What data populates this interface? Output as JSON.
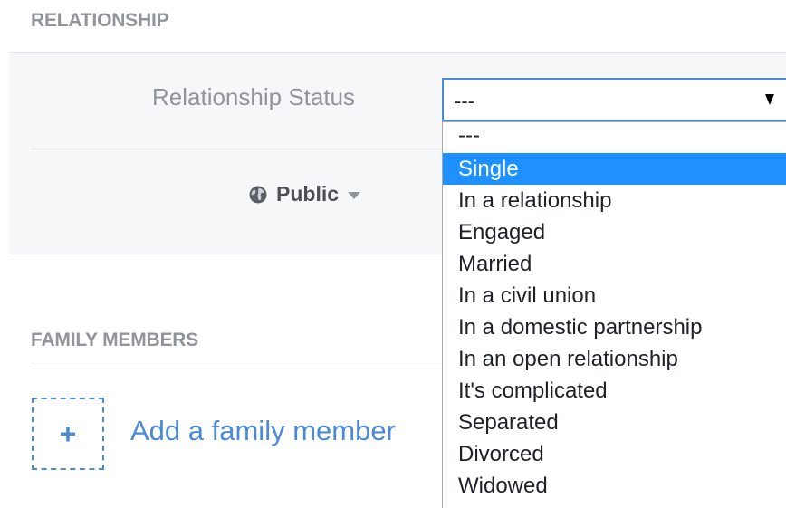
{
  "relationship_section": {
    "heading": "RELATIONSHIP",
    "status_label": "Relationship Status",
    "select_value": "---",
    "privacy_label": "Public"
  },
  "dropdown": {
    "options": [
      "---",
      "Single",
      "In a relationship",
      "Engaged",
      "Married",
      "In a civil union",
      "In a domestic partnership",
      "In an open relationship",
      "It's complicated",
      "Separated",
      "Divorced",
      "Widowed"
    ],
    "highlighted": "Single"
  },
  "family_section": {
    "heading": "FAMILY MEMBERS",
    "add_label": "Add a family member"
  },
  "icons": {
    "privacy": "globe-icon",
    "privacy_caret": "caret-down-icon",
    "select_arrow": "dropdown-arrow-icon",
    "add": "plus-icon"
  },
  "colors": {
    "accent_blue": "#4a8ad6",
    "highlight": "#1e90ff",
    "muted_text": "#90949c",
    "panel_bg": "#f6f7f9"
  }
}
